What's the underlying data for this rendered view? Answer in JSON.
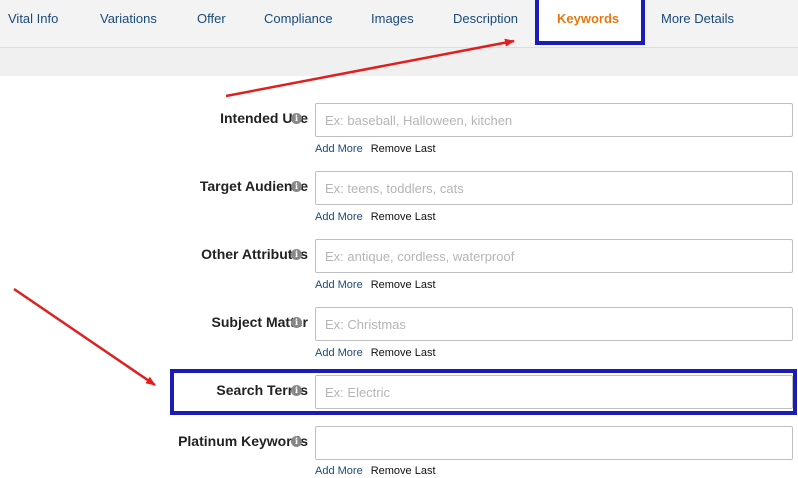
{
  "tabs": [
    {
      "label": "Vital Info"
    },
    {
      "label": "Variations"
    },
    {
      "label": "Offer"
    },
    {
      "label": "Compliance"
    },
    {
      "label": "Images"
    },
    {
      "label": "Description"
    },
    {
      "label": "Keywords",
      "active": true
    },
    {
      "label": "More Details"
    }
  ],
  "fields": [
    {
      "label": "Intended Use",
      "placeholder": "Ex: baseball, Halloween, kitchen",
      "add": "Add More",
      "remove": "Remove Last"
    },
    {
      "label": "Target Audience",
      "placeholder": "Ex: teens, toddlers, cats",
      "add": "Add More",
      "remove": "Remove Last"
    },
    {
      "label": "Other Attributes",
      "placeholder": "Ex: antique, cordless, waterproof",
      "add": "Add More",
      "remove": "Remove Last"
    },
    {
      "label": "Subject Matter",
      "placeholder": "Ex: Christmas",
      "add": "Add More",
      "remove": "Remove Last"
    },
    {
      "label": "Search Terms",
      "placeholder": "Ex: Electric"
    },
    {
      "label": "Platinum Keywords",
      "placeholder": "",
      "add": "Add More",
      "remove": "Remove Last"
    }
  ],
  "info_icon": "info-icon",
  "colors": {
    "active_tab": "#e47911",
    "tab_text": "#1a4a7a",
    "highlight_box": "#1b1bb5",
    "annotation_arrow": "#e02020"
  }
}
